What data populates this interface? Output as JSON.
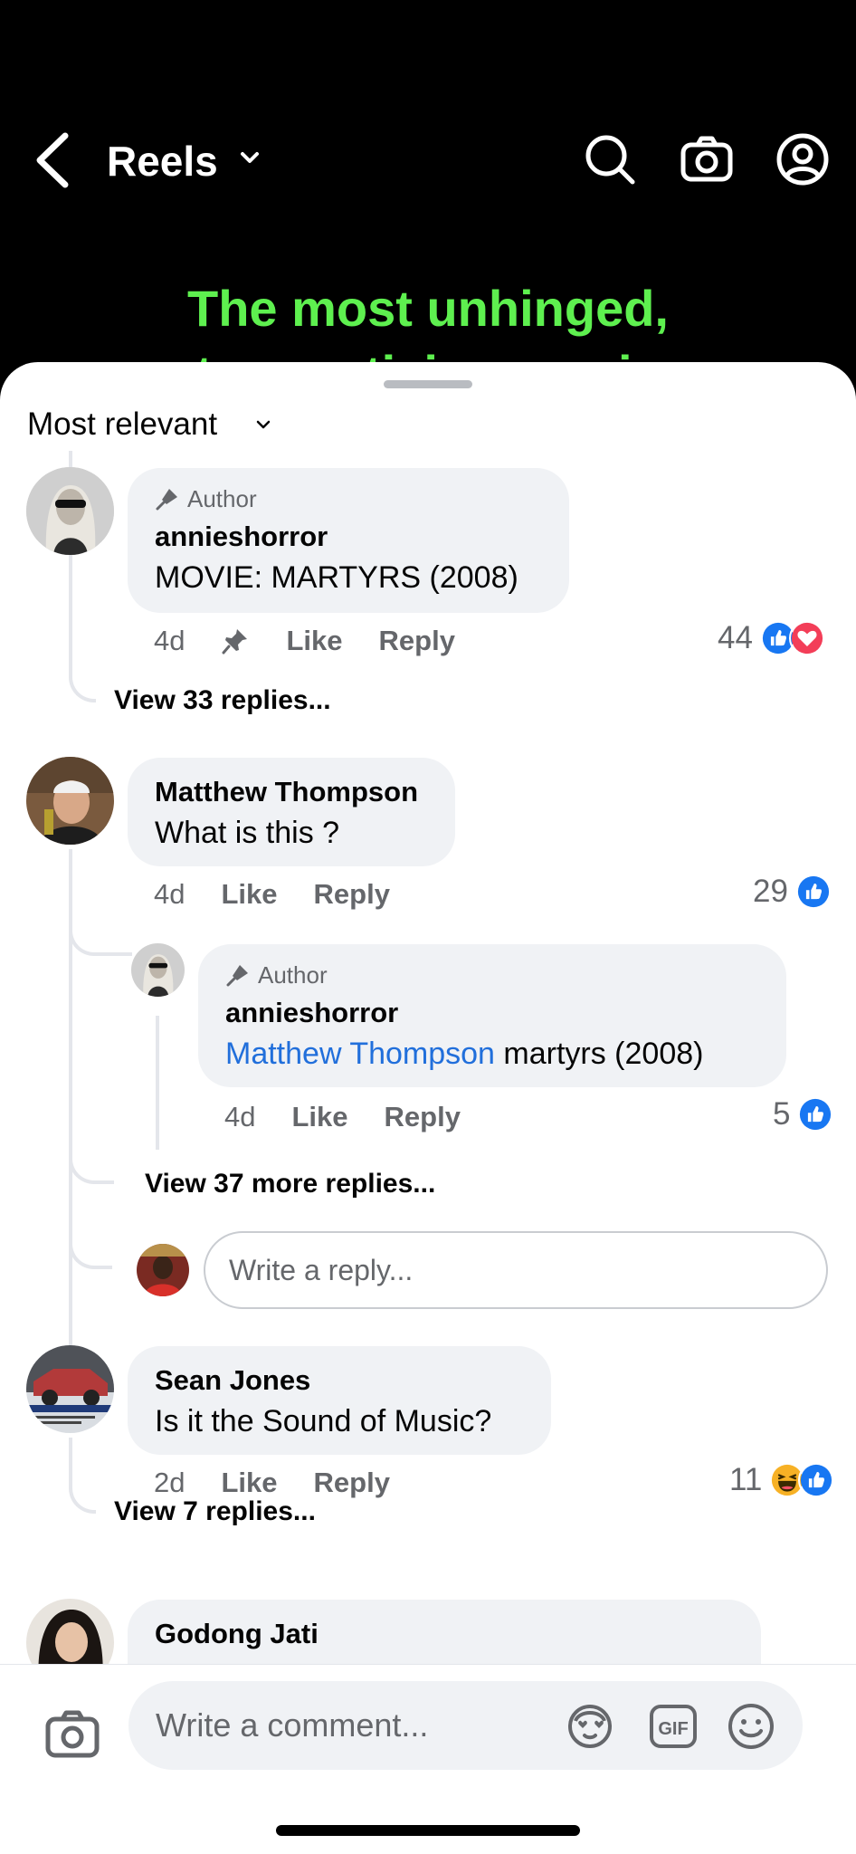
{
  "header": {
    "title": "Reels",
    "video_caption_line1": "The most unhinged,",
    "video_caption_line2": "traumatising movie"
  },
  "sheet": {
    "sort_label": "Most relevant"
  },
  "comments": [
    {
      "author_tag": "Author",
      "name": "annieshorror",
      "text": "MOVIE: MARTYRS (2008)",
      "time": "4d",
      "like": "Like",
      "reply": "Reply",
      "count": "44",
      "view_replies": "View 33 replies..."
    },
    {
      "name": "Matthew Thompson",
      "text": "What is this ?",
      "time": "4d",
      "like": "Like",
      "reply": "Reply",
      "count": "29",
      "reply_item": {
        "author_tag": "Author",
        "name": "annieshorror",
        "mention": "Matthew Thompson",
        "text": " martyrs (2008)",
        "time": "4d",
        "like": "Like",
        "reply": "Reply",
        "count": "5"
      },
      "view_more": "View 37 more replies...",
      "reply_placeholder": "Write a reply..."
    },
    {
      "name": "Sean Jones",
      "text": "Is it the Sound of Music?",
      "time": "2d",
      "like": "Like",
      "reply": "Reply",
      "count": "11",
      "view_replies": "View 7 replies..."
    },
    {
      "name": "Godong Jati"
    }
  ],
  "composer": {
    "placeholder": "Write a comment..."
  },
  "colors": {
    "like_blue": "#1877f2",
    "love_red": "#f33e58",
    "mention_blue": "#216fdb",
    "caption_green": "#5ef04f"
  }
}
